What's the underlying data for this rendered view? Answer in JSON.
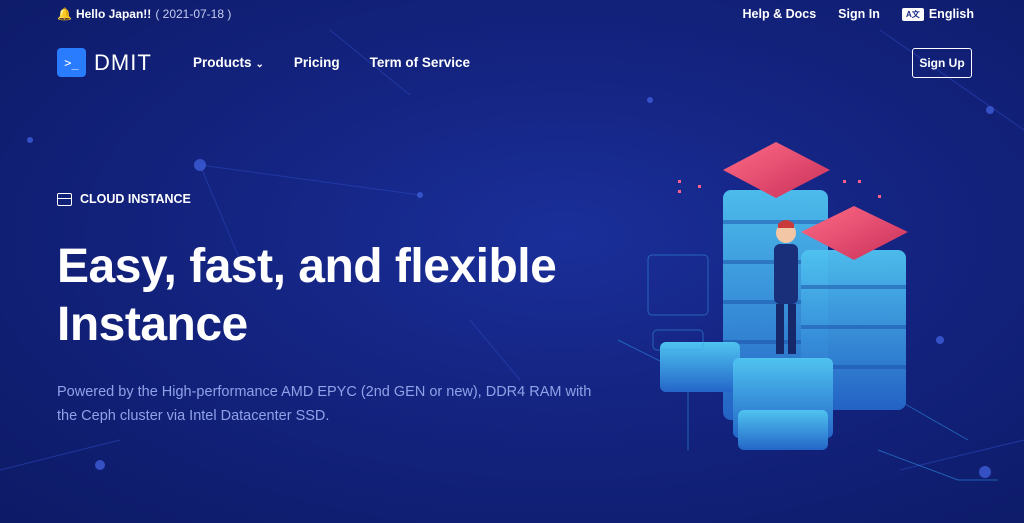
{
  "topbar": {
    "announcement": "Hello Japan!!",
    "announcement_date": "( 2021-07-18 )",
    "help": "Help & Docs",
    "signin": "Sign In",
    "language": "English"
  },
  "nav": {
    "logo_mark": ">_",
    "brand": "DMIT",
    "menu": [
      {
        "label": "Products"
      },
      {
        "label": "Pricing"
      },
      {
        "label": "Term of Service"
      }
    ],
    "signup": "Sign Up"
  },
  "hero": {
    "kicker": "CLOUD INSTANCE",
    "headline_line1": "Easy, fast, and flexible",
    "headline_line2": "Instance",
    "description": "Powered by the High-performance AMD EPYC (2nd GEN or new), DDR4 RAM with the Ceph cluster via Intel Datacenter SSD."
  },
  "colors": {
    "background": "#142482",
    "accent": "#2a7cff",
    "server_top": "#e04a6a",
    "server_body": "#3aa8e0"
  }
}
